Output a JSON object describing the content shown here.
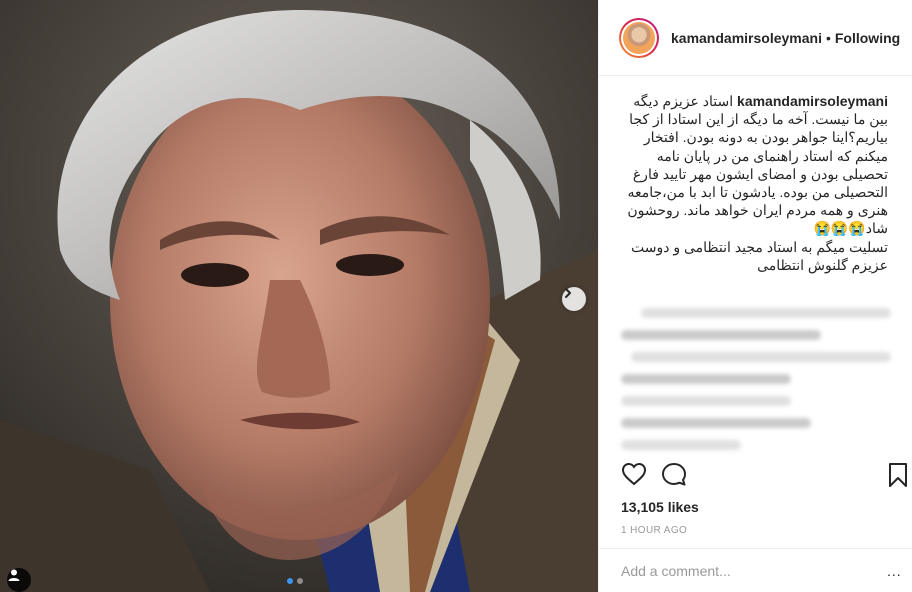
{
  "post": {
    "username": "kamandamirsoleymani",
    "separator": "•",
    "follow_state": "Following",
    "caption_user": "kamandamirsoleymani",
    "caption_text": "استاد عزیزم دیگه بین ما نیست. آخه ما دیگه از این استادا از کجا بیاریم؟اینا جواهر بودن به دونه بودن. افتخار میکنم که استاد راهنمای من در پایان نامه تحصیلی بودن و امضای ایشون مهر تایید فارغ التحصیلی من بوده. یادشون تا ابد با من،جامعه هنری و همه مردم ایران خواهد ماند. روحشون شاد😭😭😭",
    "caption_text_2": "تسلیت میگم به استاد مجید انتظامی و دوست عزیزم گلنوش انتظامی",
    "likes": "13,105 likes",
    "time": "1 HOUR AGO",
    "comment_placeholder": "Add a comment...",
    "more_label": "..."
  },
  "icons": {
    "heart": "heart-icon",
    "comment": "comment-icon",
    "bookmark": "bookmark-icon",
    "next": "chevron-right-icon",
    "tag": "user-tag-icon"
  },
  "colors": {
    "accent": "#3897f0",
    "text": "#262626",
    "muted": "#999999"
  }
}
